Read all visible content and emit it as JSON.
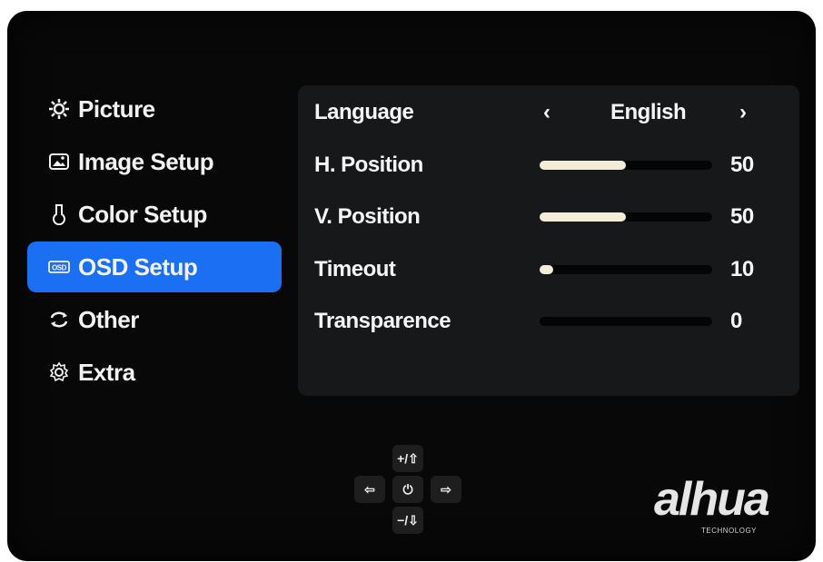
{
  "menu": {
    "items": [
      {
        "label": "Picture",
        "icon": "sun-icon"
      },
      {
        "label": "Image Setup",
        "icon": "image-icon"
      },
      {
        "label": "Color Setup",
        "icon": "flask-icon"
      },
      {
        "label": "OSD Setup",
        "icon": "osd-icon",
        "active": true
      },
      {
        "label": "Other",
        "icon": "refresh-icon"
      },
      {
        "label": "Extra",
        "icon": "gear-icon"
      }
    ]
  },
  "osd": {
    "language": {
      "label": "Language",
      "value": "English",
      "prev": "‹",
      "next": "›"
    },
    "h_position": {
      "label": "H. Position",
      "value": "50",
      "level": 0.5
    },
    "v_position": {
      "label": "V. Position",
      "value": "50",
      "level": 0.5
    },
    "timeout": {
      "label": "Timeout",
      "value": "10",
      "level": 0.08
    },
    "transparence": {
      "label": "Transparence",
      "value": "0",
      "level": 0
    }
  },
  "controls": {
    "up": "+/⇧",
    "down": "−/⇩",
    "left": "⇦",
    "right": "⇨",
    "power": "⏻"
  },
  "brand": {
    "name": "alhua",
    "sub": "TECHNOLOGY"
  },
  "colors": {
    "accent": "#1a6ff2",
    "slider_fill": "#f3ecd8",
    "panel": "#171819"
  }
}
